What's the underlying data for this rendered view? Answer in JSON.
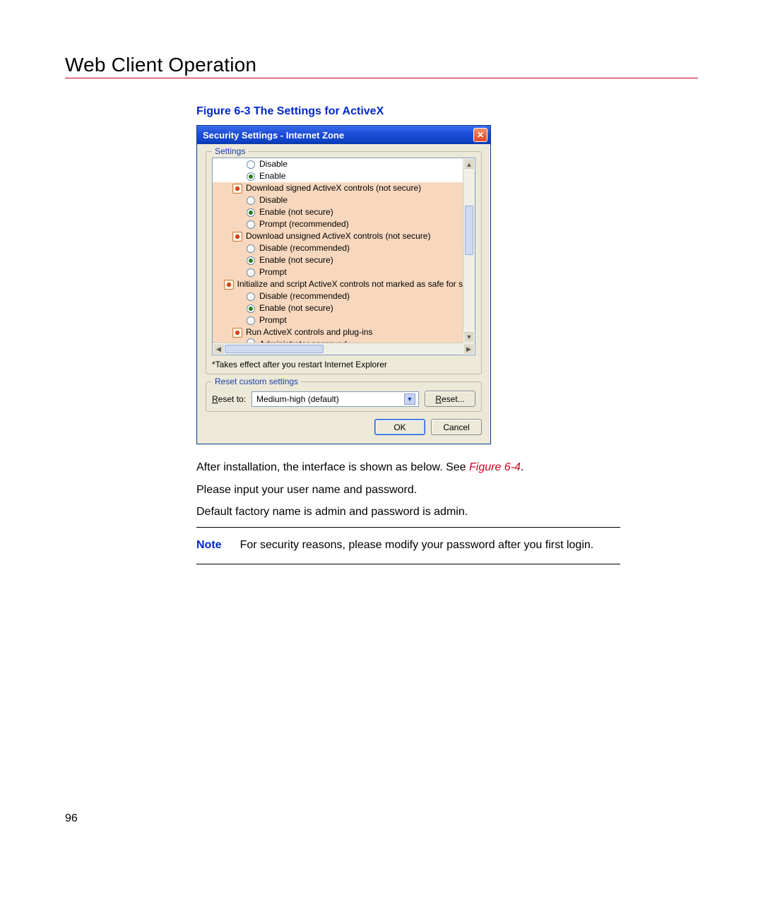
{
  "page": {
    "heading": "Web Client Operation",
    "figure_caption": "Figure 6-3 The Settings for ActiveX",
    "page_number": "96"
  },
  "dialog": {
    "title": "Security Settings - Internet Zone",
    "settings_group": {
      "legend": "Settings",
      "restart_note": "*Takes effect after you restart Internet Explorer",
      "items": [
        {
          "type": "option",
          "indent": 3,
          "selected": false,
          "label": "Disable"
        },
        {
          "type": "option",
          "indent": 3,
          "selected": true,
          "label": "Enable"
        },
        {
          "type": "header",
          "indent": 2,
          "label": "Download signed ActiveX controls (not secure)"
        },
        {
          "type": "option",
          "indent": 3,
          "selected": false,
          "label": "Disable"
        },
        {
          "type": "option",
          "indent": 3,
          "selected": true,
          "label": "Enable (not secure)"
        },
        {
          "type": "option",
          "indent": 3,
          "selected": false,
          "label": "Prompt (recommended)"
        },
        {
          "type": "header",
          "indent": 2,
          "label": "Download unsigned ActiveX controls (not secure)"
        },
        {
          "type": "option",
          "indent": 3,
          "selected": false,
          "label": "Disable (recommended)"
        },
        {
          "type": "option",
          "indent": 3,
          "selected": true,
          "label": "Enable (not secure)"
        },
        {
          "type": "option",
          "indent": 3,
          "selected": false,
          "label": "Prompt"
        },
        {
          "type": "header",
          "indent": 2,
          "label": "Initialize and script ActiveX controls not marked as safe for s"
        },
        {
          "type": "option",
          "indent": 3,
          "selected": false,
          "label": "Disable (recommended)"
        },
        {
          "type": "option",
          "indent": 3,
          "selected": true,
          "label": "Enable (not secure)"
        },
        {
          "type": "option",
          "indent": 3,
          "selected": false,
          "label": "Prompt"
        },
        {
          "type": "header",
          "indent": 2,
          "label": "Run ActiveX controls and plug-ins"
        },
        {
          "type": "option",
          "indent": 3,
          "selected": false,
          "label": "Administrator approved",
          "cut": true
        }
      ]
    },
    "reset_group": {
      "legend": "Reset custom settings",
      "reset_to_label_pre": "R",
      "reset_to_label_post": "eset to:",
      "select_value": "Medium-high (default)",
      "reset_button_pre": "R",
      "reset_button_post": "eset..."
    },
    "ok_button": "OK",
    "cancel_button": "Cancel"
  },
  "body_text": {
    "p1_a": "After installation, the interface is shown as below. See ",
    "p1_ref": "Figure 6-4",
    "p1_b": ".",
    "p2": "Please input your user name and password.",
    "p3": "Default factory name is admin and password is admin.",
    "note_label": "Note",
    "note_text": "For security reasons, please modify your password after you first login."
  }
}
